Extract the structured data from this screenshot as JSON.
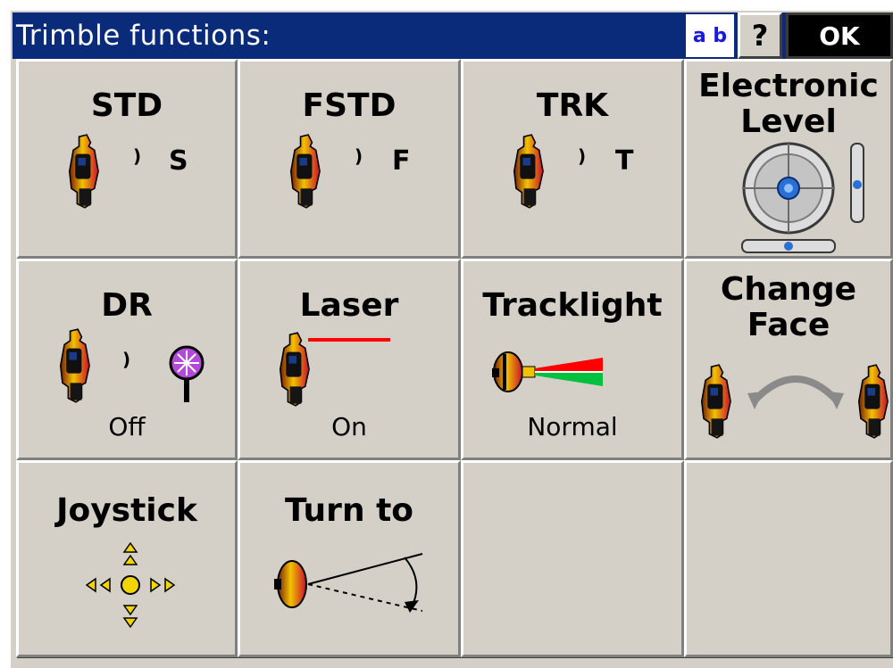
{
  "window": {
    "title": "Trimble functions:",
    "ab_label": "a b",
    "help_label": "?",
    "ok_label": "OK"
  },
  "buttons": [
    {
      "label": "STD",
      "mode_letter": "S",
      "icon": "instrument-icon"
    },
    {
      "label": "FSTD",
      "mode_letter": "F",
      "icon": "instrument-icon"
    },
    {
      "label": "TRK",
      "mode_letter": "T",
      "icon": "instrument-icon"
    },
    {
      "label_line1": "Electronic",
      "label_line2": "Level",
      "icon": "bubble-level-icon"
    },
    {
      "label": "DR",
      "status": "Off",
      "icon": "prism-target-icon"
    },
    {
      "label": "Laser",
      "status": "On",
      "icon": "laser-pointer-icon"
    },
    {
      "label": "Tracklight",
      "status": "Normal",
      "icon": "tracklight-icon"
    },
    {
      "label_line1": "Change",
      "label_line2": "Face",
      "icon": "change-face-icon"
    },
    {
      "label": "Joystick",
      "icon": "joystick-arrows-icon"
    },
    {
      "label": "Turn to",
      "icon": "turn-to-angle-icon"
    },
    {
      "label": ""
    },
    {
      "label": ""
    }
  ],
  "colors": {
    "titlebar": "#0a2b7a",
    "button_face": "#d4d0c8",
    "instrument_yellow": "#f2c200",
    "instrument_red": "#c8102e",
    "laser_red": "#ff0000",
    "tracklight_green": "#00c040",
    "prism_purple": "#b44bd8",
    "level_blue": "#2a6fd6"
  }
}
